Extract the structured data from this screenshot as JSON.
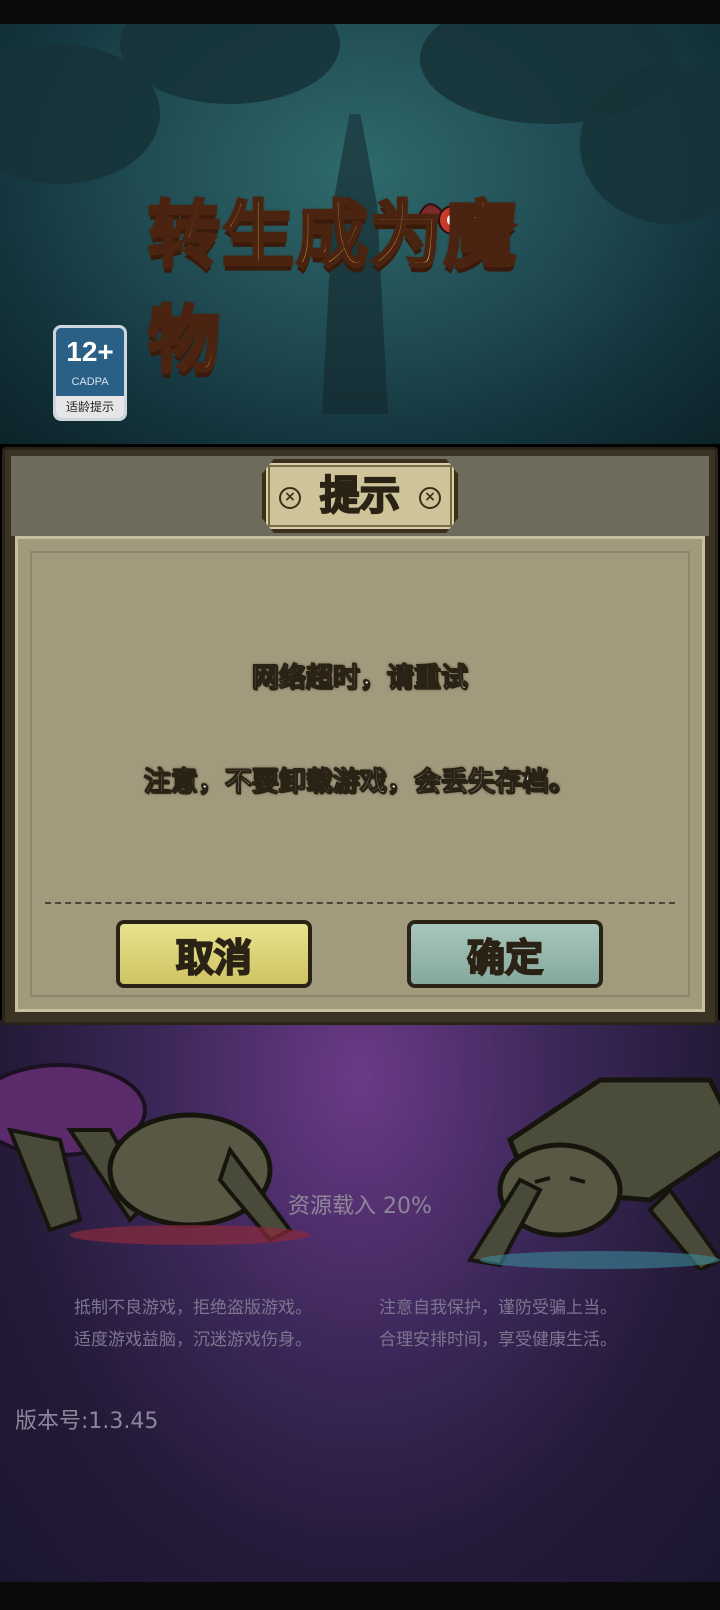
{
  "game": {
    "title_logo": "转生成为魔物",
    "age_rating": {
      "number": "12+",
      "org": "CADPA",
      "tip": "适龄提示"
    }
  },
  "dialog": {
    "title": "提示",
    "message_1": "网络超时，请重试",
    "message_2": "注意，不要卸载游戏，会丢失存档。",
    "cancel_label": "取消",
    "confirm_label": "确定",
    "close_icon": "×"
  },
  "loading": {
    "text": "资源载入 20%",
    "progress_percent": 20
  },
  "health_notice": {
    "line_1_left": "抵制不良游戏，拒绝盗版游戏。",
    "line_1_right": "注意自我保护，谨防受骗上当。",
    "line_2_left": "适度游戏益脑，沉迷游戏伤身。",
    "line_2_right": "合理安排时间，享受健康生活。"
  },
  "version": "版本号:1.3.45"
}
